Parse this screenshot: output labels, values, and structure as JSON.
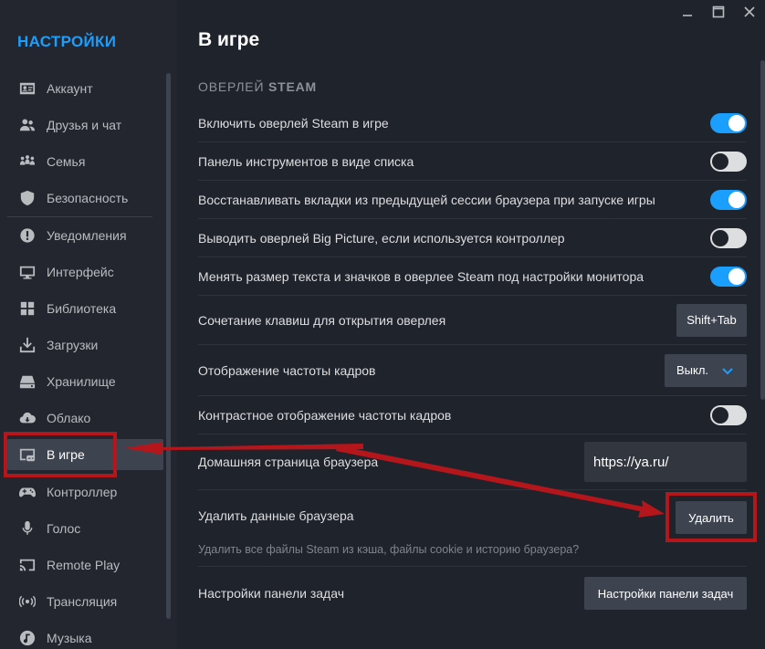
{
  "sidebar": {
    "title": "НАСТРОЙКИ",
    "items": [
      {
        "label": "Аккаунт",
        "icon": "id-card-icon"
      },
      {
        "label": "Друзья и чат",
        "icon": "people-icon"
      },
      {
        "label": "Семья",
        "icon": "family-icon"
      },
      {
        "label": "Безопасность",
        "icon": "shield-icon"
      },
      {
        "label": "Уведомления",
        "icon": "alert-icon"
      },
      {
        "label": "Интерфейс",
        "icon": "monitor-icon"
      },
      {
        "label": "Библиотека",
        "icon": "grid-icon"
      },
      {
        "label": "Загрузки",
        "icon": "download-icon"
      },
      {
        "label": "Хранилище",
        "icon": "drive-icon"
      },
      {
        "label": "Облако",
        "icon": "cloud-icon"
      },
      {
        "label": "В игре",
        "icon": "in-game-icon",
        "active": true
      },
      {
        "label": "Контроллер",
        "icon": "gamepad-icon"
      },
      {
        "label": "Голос",
        "icon": "microphone-icon"
      },
      {
        "label": "Remote Play",
        "icon": "cast-icon"
      },
      {
        "label": "Трансляция",
        "icon": "broadcast-icon"
      },
      {
        "label": "Музыка",
        "icon": "music-icon"
      }
    ]
  },
  "main": {
    "title": "В игре",
    "section_prefix": "ОВЕРЛЕЙ",
    "section_bold": "STEAM",
    "rows": {
      "overlay_enable": {
        "label": "Включить оверлей Steam в игре",
        "on": true
      },
      "toolbar_list": {
        "label": "Панель инструментов в виде списка",
        "on": false
      },
      "restore_tabs": {
        "label": "Восстанавливать вкладки из предыдущей сессии браузера при запуске игры",
        "on": true
      },
      "big_picture": {
        "label": "Выводить оверлей Big Picture, если используется контроллер",
        "on": false
      },
      "scale_text": {
        "label": "Менять размер текста и значков в оверлее Steam под настройки монитора",
        "on": true
      },
      "shortcut": {
        "label": "Сочетание клавиш для открытия оверлея",
        "value": "Shift+Tab"
      },
      "fps": {
        "label": "Отображение частоты кадров",
        "value": "Выкл."
      },
      "fps_contrast": {
        "label": "Контрастное отображение частоты кадров",
        "on": false
      },
      "homepage": {
        "label": "Домашняя страница браузера",
        "value": "https://ya.ru/"
      },
      "delete_data": {
        "label": "Удалить данные браузера",
        "button": "Удалить",
        "description": "Удалить все файлы Steam из кэша, файлы cookie и историю браузера?"
      },
      "taskbar": {
        "label": "Настройки панели задач",
        "button": "Настройки панели задач"
      }
    }
  },
  "colors": {
    "accent": "#1a9fff",
    "annotation": "#b4161b"
  }
}
